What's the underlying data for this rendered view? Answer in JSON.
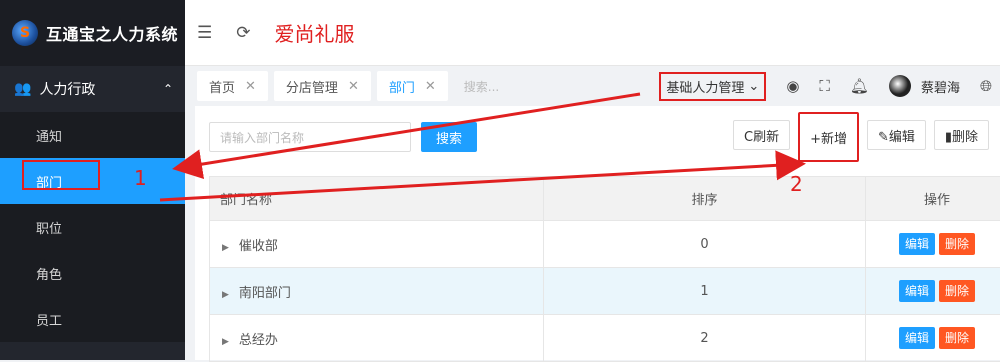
{
  "sidebar": {
    "logo_text": "互通宝之人力系统",
    "logo_mark": "S",
    "group": {
      "icon": "users-icon",
      "label": "人力行政",
      "chevron": "⌃"
    },
    "items": [
      {
        "label": "通知",
        "active": false
      },
      {
        "label": "部门",
        "active": true
      },
      {
        "label": "职位",
        "active": false
      },
      {
        "label": "角色",
        "active": false
      },
      {
        "label": "员工",
        "active": false
      }
    ]
  },
  "header": {
    "menu_icon": "☰",
    "refresh_icon": "⟳",
    "title": "爱尚礼服"
  },
  "tabs": {
    "items": [
      {
        "label": "首页",
        "close": "✕"
      },
      {
        "label": "分店管理",
        "close": "✕"
      },
      {
        "label": "部门",
        "close": "✕",
        "active": true
      }
    ],
    "search_placeholder": "搜索..."
  },
  "topbar": {
    "select_value": "基础人力管理",
    "select_arrow": "⌄",
    "user_name": "蔡碧海",
    "icons": [
      "target-icon",
      "fullscreen-icon",
      "bell-icon",
      "globe-icon"
    ]
  },
  "toolbar": {
    "search_placeholder": "请输入部门名称",
    "search_button": "搜索",
    "refresh_button": "C刷新",
    "add_button": "+新增",
    "edit_button": "✎编辑",
    "delete_button": "▮删除"
  },
  "table": {
    "headers": [
      "部门名称",
      "排序",
      "操作"
    ],
    "rows": [
      {
        "name": "催收部",
        "order": "0",
        "edit": "编辑",
        "del": "删除"
      },
      {
        "name": "南阳部门",
        "order": "1",
        "edit": "编辑",
        "del": "删除",
        "hover": true
      },
      {
        "name": "总经办",
        "order": "2",
        "edit": "编辑",
        "del": "删除"
      }
    ]
  },
  "annotations": {
    "label_1": "1",
    "label_2": "2",
    "color": "#e02020"
  },
  "colors": {
    "accent": "#1e9fff",
    "sidebar_bg": "#23262e",
    "danger": "#ff5722"
  }
}
